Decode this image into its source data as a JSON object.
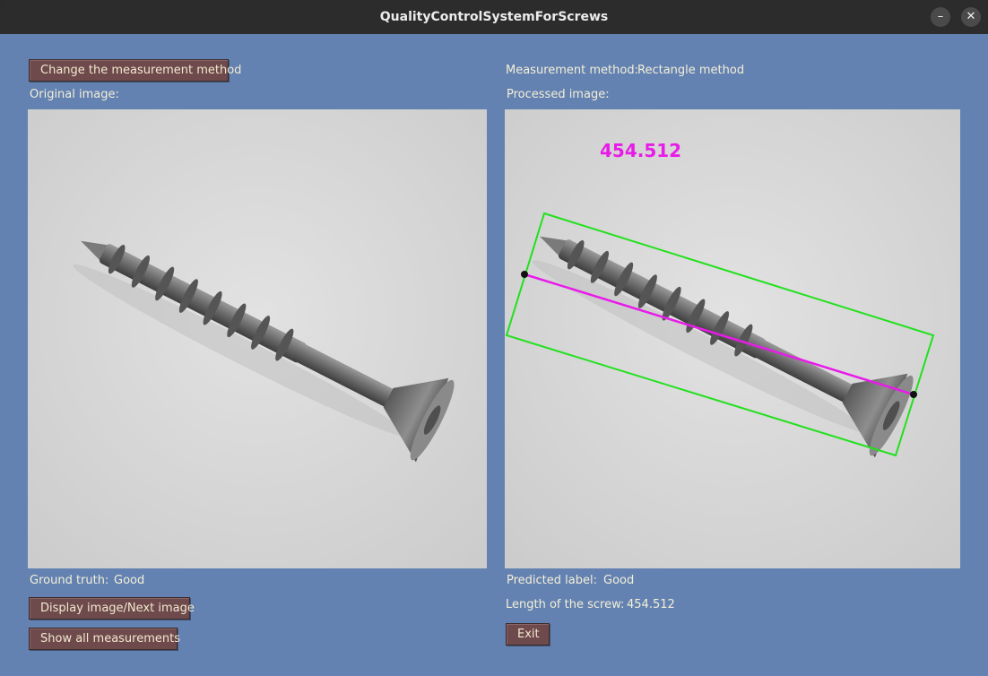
{
  "window": {
    "title": "QualityControlSystemForScrews",
    "minimize_symbol": "–",
    "close_symbol": "✕"
  },
  "left": {
    "change_method_button": "Change the measurement method",
    "original_label": "Original image:",
    "ground_truth_label": "Ground truth:",
    "ground_truth_value": "Good",
    "display_next_button": "Display image/Next image",
    "show_all_button": "Show all measurements"
  },
  "right": {
    "method_label": "Measurement method:",
    "method_value": "Rectangle method",
    "processed_label": "Processed image:",
    "overlay_value": "454.512",
    "predicted_label": "Predicted label:",
    "predicted_value": "Good",
    "length_label": "Length of the screw:",
    "length_value": "454.512",
    "exit_button": "Exit"
  },
  "colors": {
    "client_bg": "#6382b2",
    "button_bg": "#6e4a4c",
    "label_text": "#f4efd6",
    "overlay_text": "#e81be8",
    "bbox_color": "#22e01e",
    "length_line": "#e81be8"
  }
}
